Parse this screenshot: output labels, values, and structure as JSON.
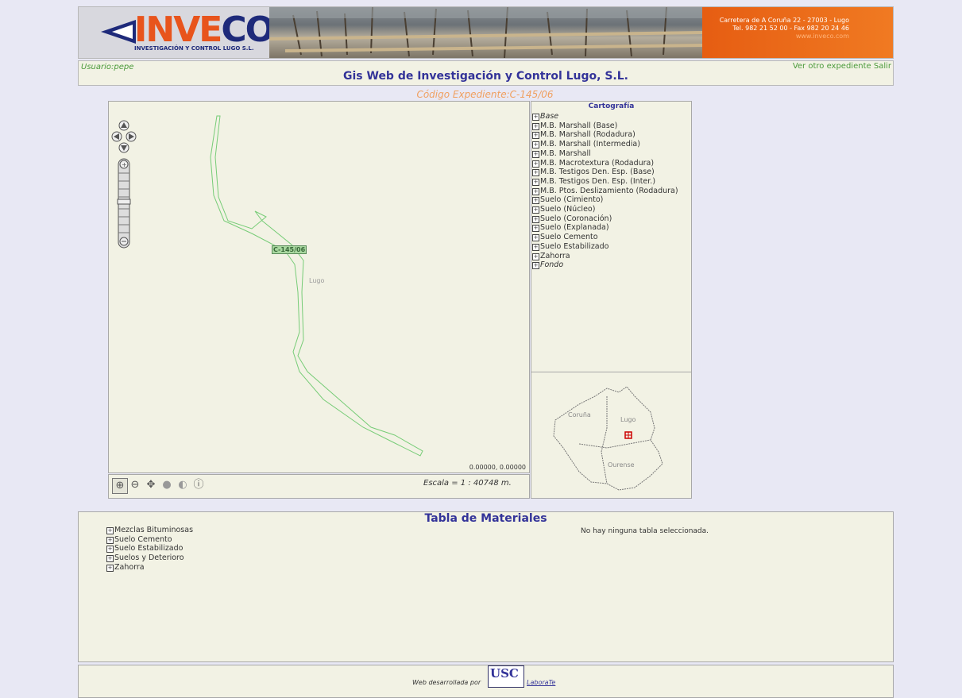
{
  "banner": {
    "logo": "INVECO",
    "logo_sub": "INVESTIGACIÓN Y CONTROL LUGO S.L.",
    "address_line1": "Carretera de A Coruña 22 - 27003 - Lugo",
    "address_line2": "Tel. 982 21 52 00 - Fax 982 20 24 46",
    "address_line3": "www.inveco.com"
  },
  "header": {
    "user": "Usuario:pepe",
    "title": "Gis Web de Investigación y Control Lugo, S.L.",
    "nav_other": "Ver otro expediente",
    "nav_exit": "Salir"
  },
  "expediente": "Código Expediente:C-145/06",
  "map": {
    "feature_label": "C-145/06",
    "place_label": "Lugo",
    "coords": "0.00000, 0.00000",
    "scale": "Escala = 1 : 40748 m.",
    "tools": [
      "zoom-in",
      "zoom-out",
      "pan",
      "zoom-extent",
      "zoom-previous",
      "info"
    ]
  },
  "cartografia": {
    "title": "Cartografía",
    "layers": [
      {
        "label": "Base",
        "italic": true
      },
      {
        "label": "M.B. Marshall (Base)"
      },
      {
        "label": "M.B. Marshall (Rodadura)"
      },
      {
        "label": "M.B. Marshall (Intermedia)"
      },
      {
        "label": "M.B. Marshall"
      },
      {
        "label": "M.B. Macrotextura (Rodadura)"
      },
      {
        "label": "M.B. Testigos Den. Esp. (Base)"
      },
      {
        "label": "M.B. Testigos Den. Esp. (Inter.)"
      },
      {
        "label": "M.B. Ptos. Deslizamiento (Rodadura)"
      },
      {
        "label": "Suelo (Cimiento)"
      },
      {
        "label": "Suelo (Núcleo)"
      },
      {
        "label": "Suelo (Coronación)"
      },
      {
        "label": "Suelo (Explanada)"
      },
      {
        "label": "Suelo Cemento"
      },
      {
        "label": "Suelo Estabilizado"
      },
      {
        "label": "Zahorra"
      },
      {
        "label": "Fondo",
        "italic": true
      }
    ]
  },
  "overview": {
    "labels": [
      "Coruña",
      "Lugo",
      "Ourense"
    ]
  },
  "tabla": {
    "title": "Tabla de Materiales",
    "message": "No hay ninguna tabla seleccionada.",
    "items": [
      "Mezclas Bituminosas",
      "Suelo Cemento",
      "Suelo Estabilizado",
      "Suelos y Deterioro",
      "Zahorra"
    ]
  },
  "footer": {
    "text": "Web desarrollada por",
    "usc": "USC",
    "link": "LaboraTe"
  },
  "colors": {
    "title_blue": "#333399",
    "user_green": "#4a9a3a",
    "expediente_orange": "#f0a060",
    "route_green": "#66cc66",
    "panel_bg": "#f2f2e4"
  }
}
